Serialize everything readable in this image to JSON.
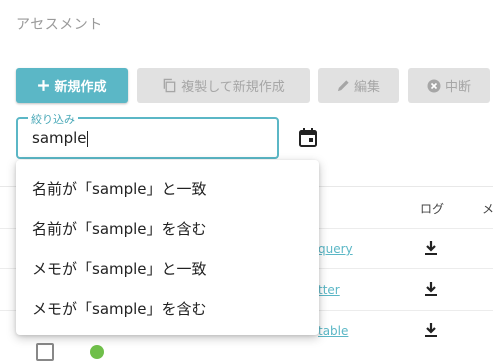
{
  "page": {
    "title": "アセスメント"
  },
  "toolbar": {
    "new_label": "新規作成",
    "copy_label": "複製して新規作成",
    "edit_label": "編集",
    "stop_label": "中断"
  },
  "filter": {
    "label": "絞り込み",
    "value": "sample"
  },
  "table": {
    "headers": [
      "ログ",
      "メ"
    ],
    "row_links": [
      "query",
      "tter",
      "table"
    ]
  },
  "suggestions": [
    "名前が「sample」と一致",
    "名前が「sample」を含む",
    "メモが「sample」と一致",
    "メモが「sample」を含む"
  ],
  "colors": {
    "accent": "#5bb7c6",
    "disabled_bg": "#e1e1e1",
    "disabled_text": "#a6a6a6"
  }
}
